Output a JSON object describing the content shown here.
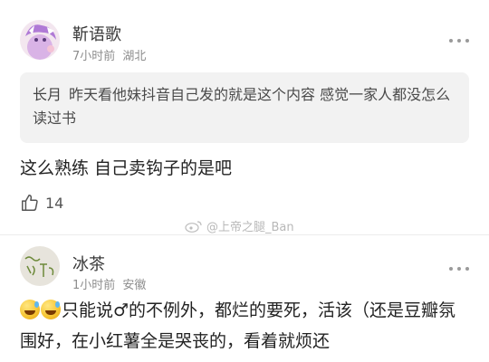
{
  "comments": [
    {
      "username": "靳语歌",
      "time": "7小时前",
      "location": "湖北",
      "quote_author": "长月",
      "quote_text": "昨天看他妹抖音自己发的就是这个内容 感觉一家人都没怎么读过书",
      "content": "这么熟练 自己卖钩子的是吧",
      "likes": "14",
      "avatar_icon": "avatar-anime-girl-icon"
    },
    {
      "username": "冰茶",
      "time": "1小时前",
      "location": "安徽",
      "content": "只能说♂的不例外，都烂的要死，活该（还是豆瓣氛围好，在小红薯全是哭丧的，看着就烦还",
      "emoji_icon": "sweat-smile-emoji-icon",
      "avatar_icon": "avatar-handwriting-icon"
    }
  ],
  "watermark": "@上帝之腿_Ban",
  "colors": {
    "quote_bg": "#f2f2f2",
    "meta_text": "#8d8d8d",
    "username_text": "#3a3a3a",
    "body_text": "#222222"
  }
}
